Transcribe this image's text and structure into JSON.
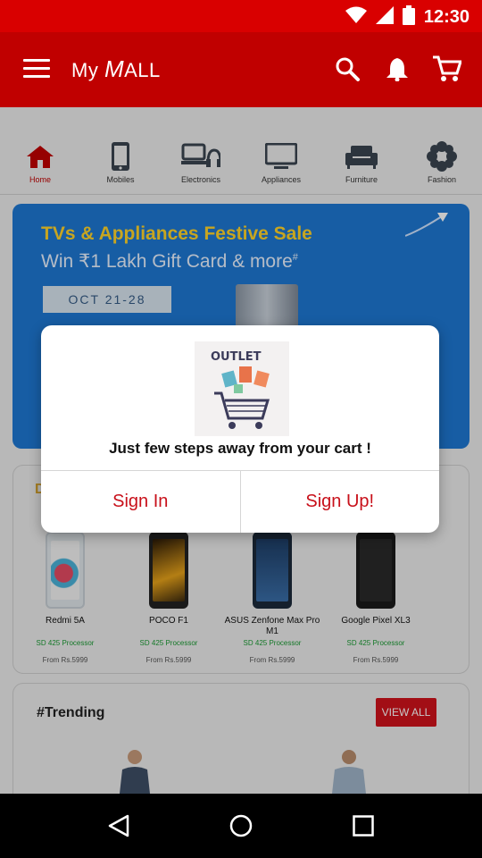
{
  "status_bar": {
    "time": "12:30",
    "icons": [
      "wifi-icon",
      "signal-icon",
      "battery-icon"
    ]
  },
  "app_bar": {
    "brand_prefix": "My",
    "brand_mid": "M",
    "brand_suffix": "ALL",
    "actions": [
      "search-icon",
      "notifications-icon",
      "cart-icon"
    ]
  },
  "categories": [
    {
      "label": "Home",
      "icon": "home-icon",
      "active": true
    },
    {
      "label": "Mobiles",
      "icon": "mobile-icon"
    },
    {
      "label": "Electronics",
      "icon": "electronics-icon"
    },
    {
      "label": "Appliances",
      "icon": "tv-icon"
    },
    {
      "label": "Furniture",
      "icon": "sofa-icon"
    },
    {
      "label": "Fashion",
      "icon": "flower-icon"
    }
  ],
  "banner": {
    "title": "TVs & Appliances Festive Sale",
    "subtitle": "Win ₹1 Lakh Gift Card & more",
    "subtitle_mark": "#",
    "date": "OCT 21-28"
  },
  "deals": {
    "section_initial": "D",
    "products": [
      {
        "name": "Redmi 5A",
        "spec": "SD 425 Processor",
        "price": "From Rs.5999"
      },
      {
        "name": "POCO F1",
        "spec": "SD 425 Processor",
        "price": "From Rs.5999"
      },
      {
        "name": "ASUS Zenfone Max Pro M1",
        "spec": "SD 425 Processor",
        "price": "From Rs.5999"
      },
      {
        "name": "Google Pixel XL3",
        "spec": "SD 425 Processor",
        "price": "From Rs.5999"
      }
    ]
  },
  "trending": {
    "title": "#Trending",
    "view_all": "VIEW ALL"
  },
  "dialog": {
    "image_text": "OUTLET",
    "message": "Just few steps away from your cart !",
    "sign_in": "Sign In",
    "sign_up": "Sign Up!"
  },
  "colors": {
    "primary": "#c00000",
    "status_bar": "#d90000",
    "banner": "#1e78d2",
    "accent_text": "#c8101a",
    "spec_green": "#1a9a33"
  }
}
